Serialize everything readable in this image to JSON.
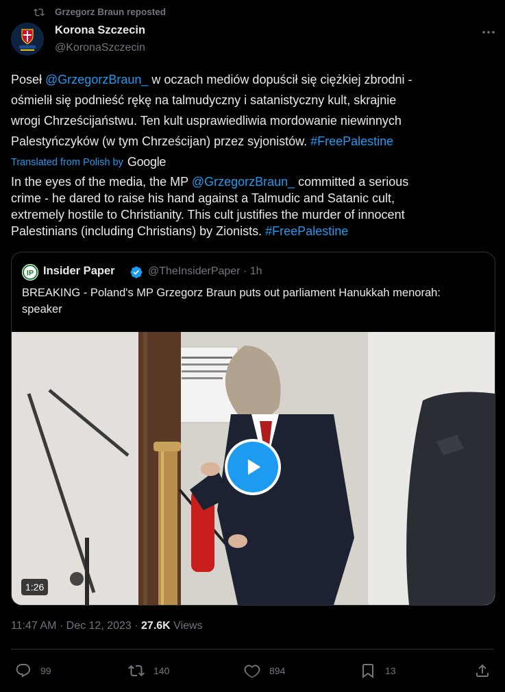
{
  "repost": {
    "text": "Grzegorz Braun reposted",
    "icon": "repost-icon"
  },
  "author": {
    "name": "Korona Szczecin",
    "handle": "@KoronaSzczecin",
    "avatar_icon": "crest-avatar"
  },
  "original_text": {
    "line1_a": "Poseł ",
    "line1_mention": "@GrzegorzBraun_",
    "line1_b": " w oczach mediów dopuścił się ciężkiej zbrodni -",
    "line2": "ośmielił się podnieść rękę na talmudyczny i satanistyczny kult, skrajnie",
    "line3": "wrogi Chrześcijaństwu. Ten kult usprawiedliwia mordowanie niewinnych",
    "line4_a": "Palestyńczyków (w tym Chrześcijan) przez syjonistów. ",
    "line4_hashtag": "#FreePalestine"
  },
  "translation": {
    "label": "Translated from Polish by",
    "provider": "Google",
    "line1_a": "In the eyes of the media, the MP ",
    "line1_mention": "@GrzegorzBraun_",
    "line1_b": " committed a serious",
    "line2": "crime - he dared to raise his hand against a Talmudic and Satanic cult,",
    "line3": "extremely hostile to Christianity. This cult justifies the murder of innocent",
    "line4_a": "Palestinians (including Christians) by Zionists. ",
    "line4_hashtag": "#FreePalestine"
  },
  "quote": {
    "name": "Insider Paper",
    "handle_time": "@TheInsiderPaper · 1h",
    "text": "BREAKING - Poland's MP Grzegorz Braun puts out parliament Hanukkah menorah: speaker",
    "video_duration": "1:26"
  },
  "meta": {
    "time": "11:47 AM · Dec 12, 2023 · ",
    "views_count": "27.6K",
    "views_label": " Views"
  },
  "actions": {
    "replies": "99",
    "reposts": "140",
    "likes": "894",
    "bookmarks": "13"
  },
  "colors": {
    "accent": "#1d9bf0",
    "background": "#000000",
    "muted": "#71767b",
    "text": "#e7e9ea"
  }
}
